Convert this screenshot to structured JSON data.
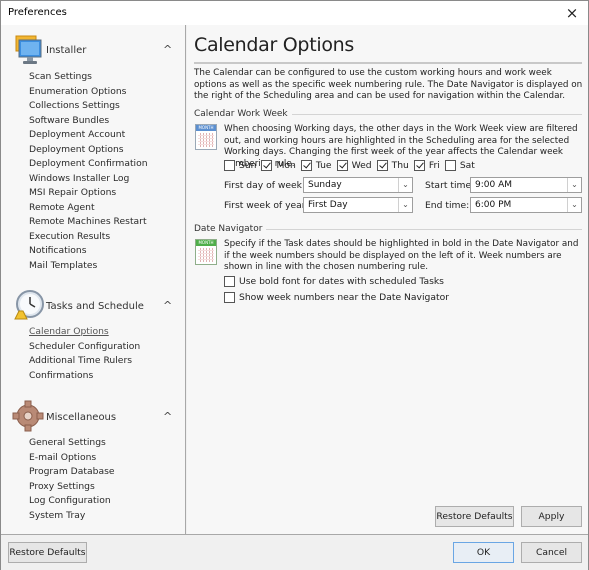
{
  "window": {
    "title": "Preferences",
    "close_icon": "×"
  },
  "sidebar": {
    "groups": [
      {
        "label": "Installer",
        "icon": "monitor-icon",
        "collapse_icon": "^",
        "items": [
          "Scan Settings",
          "Enumeration Options",
          "Collections Settings",
          "Software Bundles",
          "Deployment Account",
          "Deployment Options",
          "Deployment Confirmation",
          "Windows Installer Log",
          "MSI Repair Options",
          "Remote Agent",
          "Remote Machines Restart",
          "Execution Results",
          "Notifications",
          "Mail Templates"
        ]
      },
      {
        "label": "Tasks and Schedule",
        "icon": "clock-icon",
        "collapse_icon": "^",
        "items": [
          "Calendar Options",
          "Scheduler Configuration",
          "Additional Time Rulers",
          "Confirmations"
        ],
        "active_item": "Calendar Options"
      },
      {
        "label": "Miscellaneous",
        "icon": "gear-icon",
        "collapse_icon": "^",
        "items": [
          "General Settings",
          "E-mail Options",
          "Program Database",
          "Proxy Settings",
          "Log Configuration",
          "System Tray"
        ]
      }
    ]
  },
  "main": {
    "title": "Calendar Options",
    "intro": "The Calendar can be configured to use the custom working hours and work week options as well as the specific week numbering rule. The Date Navigator is displayed on the right of the Scheduling area and can be used for navigation within the Calendar.",
    "work_week": {
      "heading": "Calendar Work Week",
      "icon_label": "MONTH",
      "description": "When choosing Working days, the other days in the Work Week view are filtered out, and working hours are highlighted in the Scheduling area for the selected Working days. Changing the first week of the year affects the Calendar week numbering rule.",
      "days": [
        {
          "label": "Sun",
          "checked": false
        },
        {
          "label": "Mon",
          "checked": true
        },
        {
          "label": "Tue",
          "checked": true
        },
        {
          "label": "Wed",
          "checked": true
        },
        {
          "label": "Thu",
          "checked": true
        },
        {
          "label": "Fri",
          "checked": true
        },
        {
          "label": "Sat",
          "checked": false
        }
      ],
      "first_day_label": "First day of week:",
      "first_day_value": "Sunday",
      "first_week_label": "First week of year:",
      "first_week_value": "First Day",
      "start_time_label": "Start time:",
      "start_time_value": "9:00 AM",
      "end_time_label": "End time:",
      "end_time_value": "6:00 PM"
    },
    "date_navigator": {
      "heading": "Date Navigator",
      "icon_label": "MONTH",
      "description": "Specify if the Task dates should be highlighted in bold in the Date Navigator and if the week numbers should be displayed on the left of it. Week numbers are shown in line with the chosen numbering rule.",
      "options": [
        {
          "label": "Use bold font for dates with scheduled Tasks",
          "checked": false
        },
        {
          "label": "Show week numbers near the Date Navigator",
          "checked": false
        }
      ]
    },
    "restore_defaults_label": "Restore Defaults",
    "apply_label": "Apply"
  },
  "footer": {
    "restore_defaults_label": "Restore Defaults",
    "ok_label": "OK",
    "cancel_label": "Cancel"
  },
  "dropdown_arrow": "⌄"
}
